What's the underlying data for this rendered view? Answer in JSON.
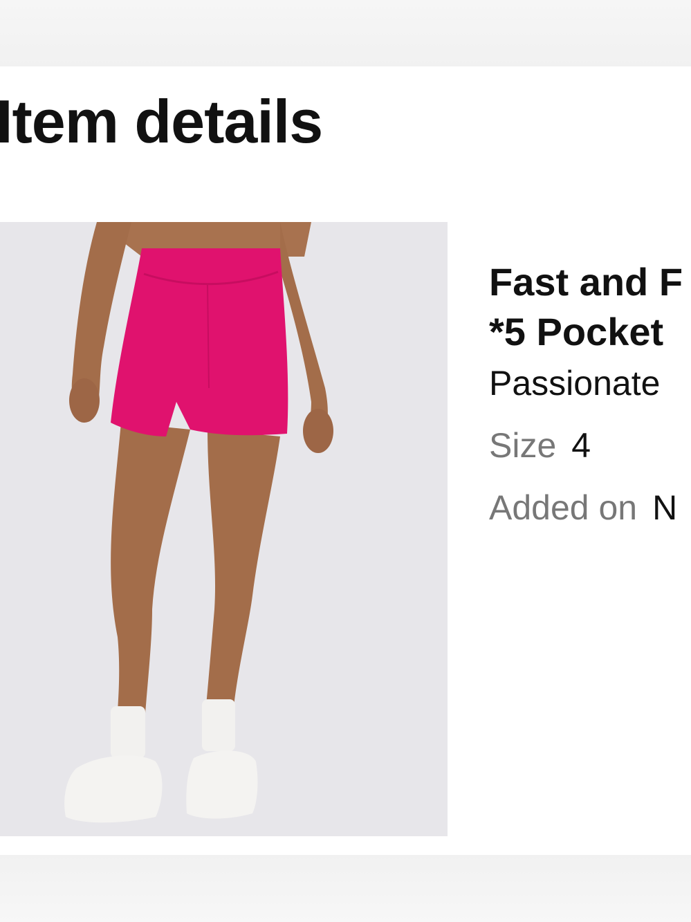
{
  "page": {
    "title": "Item details"
  },
  "product": {
    "image_alt": "product-photo-pink-bike-shorts",
    "name_line1": "Fast and F",
    "name_line2": "*5 Pocket",
    "color": "Passionate",
    "size_label": "Size",
    "size_value": "4",
    "added_label": "Added on",
    "added_value": "N"
  },
  "colors": {
    "shorts": "#e0126e",
    "background": "#ffffff",
    "muted_text": "#777777"
  }
}
